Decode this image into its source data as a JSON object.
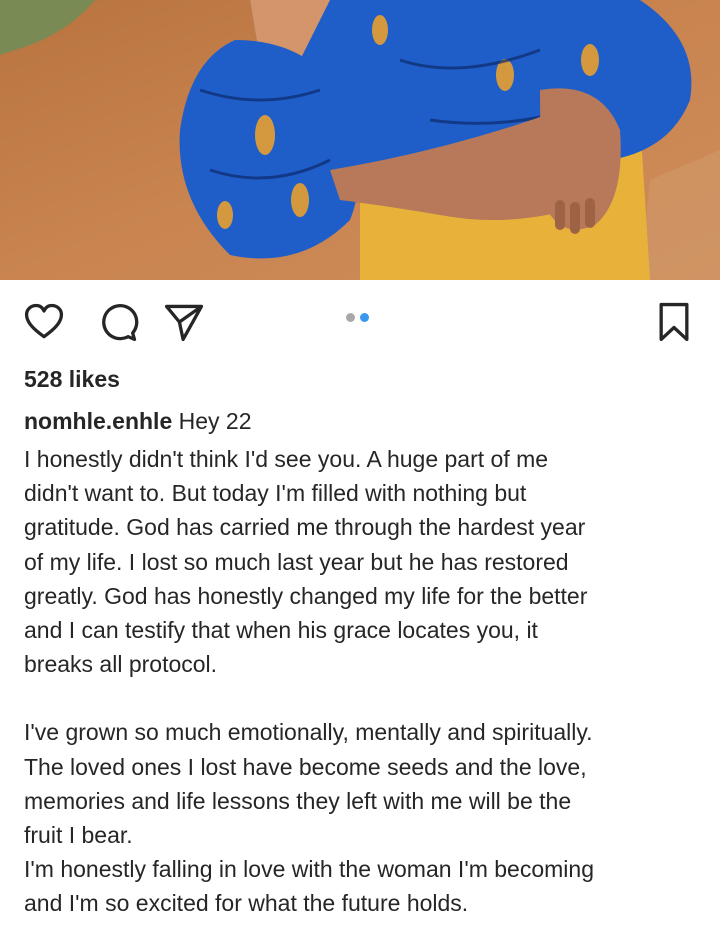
{
  "post": {
    "likes": "528 likes",
    "username": "nomhle.enhle",
    "caption_title": "Hey 22",
    "caption_paragraphs": [
      [
        "I honestly didn't think I'd see you. A huge part of me",
        "didn't want to. But today I'm filled with nothing but",
        "gratitude. God has carried me through the hardest year",
        "of my life. I lost so much last year but he has restored",
        "greatly. God has honestly changed my life for the better",
        "and I can testify that when his grace locates you, it",
        "breaks all protocol."
      ],
      [
        "I've grown so much emotionally, mentally and spiritually.",
        "The loved ones I lost have become seeds and the love,",
        "memories and life lessons they left with me will be the",
        "fruit I bear.",
        "I'm honestly falling in love with the woman I'm becoming",
        "and I'm so excited for what the future holds."
      ]
    ]
  },
  "icons": {
    "like": "heart-icon",
    "comment": "comment-icon",
    "share": "send-icon",
    "save": "bookmark-icon"
  },
  "carousel": {
    "count": 2,
    "active_index": 1
  },
  "colors": {
    "text": "#262626",
    "dot_active": "#3897f0",
    "dot_inactive": "#a8a8a8",
    "ground": "#c47a45",
    "dress_blue": "#1f5ec9",
    "skirt_yellow": "#e8b23a"
  }
}
